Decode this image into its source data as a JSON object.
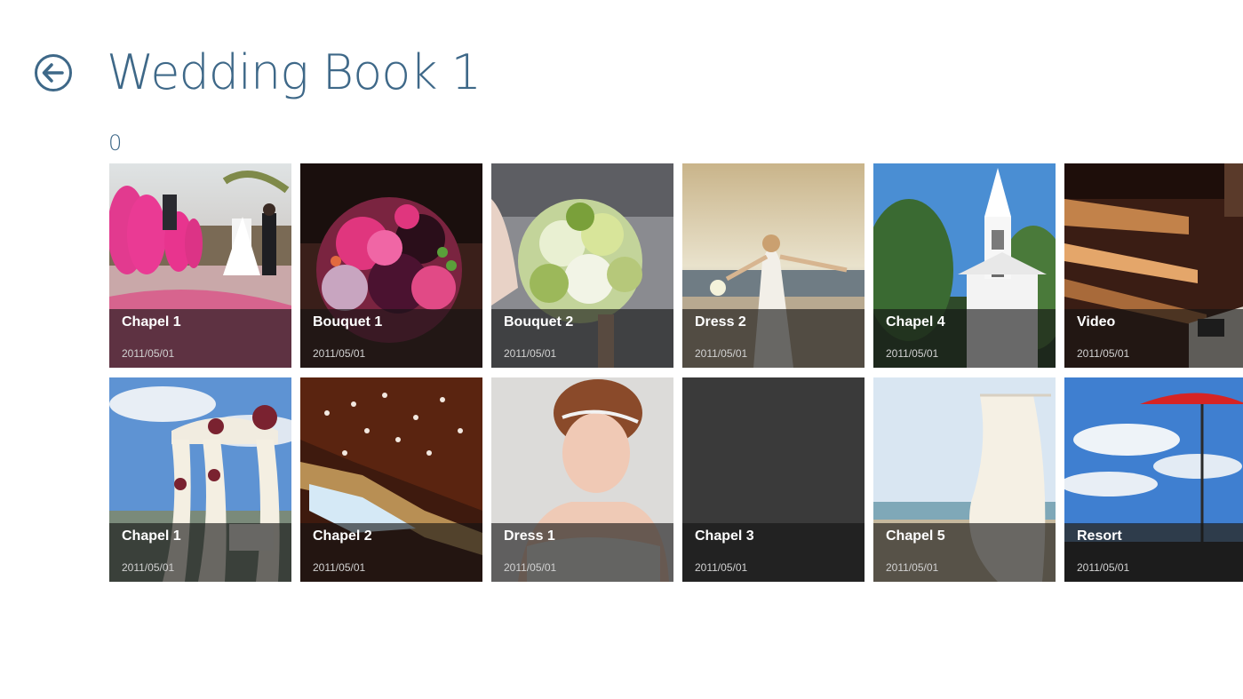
{
  "header": {
    "title": "Wedding Book 1",
    "back_icon": "back-arrow-circle-icon",
    "accent_color": "#3e6888"
  },
  "group": {
    "label": "0"
  },
  "tiles": [
    {
      "title": "Chapel 1",
      "date": "2011/05/01",
      "image": "pink parasols and aisle with rose petals"
    },
    {
      "title": "Bouquet 1",
      "date": "2011/05/01",
      "image": "pink and dark purple bouquet"
    },
    {
      "title": "Bouquet 2",
      "date": "2011/05/01",
      "image": "green and white bouquet"
    },
    {
      "title": "Dress 2",
      "date": "2011/05/01",
      "image": "bride on beach at sunset"
    },
    {
      "title": "Chapel 4",
      "date": "2011/05/01",
      "image": "white chapel steeple with trees"
    },
    {
      "title": "Video",
      "date": "2011/05/01",
      "image": "candle-lit shelves"
    },
    {
      "title": "Chapel 1",
      "date": "2011/05/01",
      "image": "white draped arbor with roses"
    },
    {
      "title": "Chapel 2",
      "date": "2011/05/01",
      "image": "petals falling under wooden beams"
    },
    {
      "title": "Dress 1",
      "date": "2011/05/01",
      "image": "bride with tiara"
    },
    {
      "title": "Chapel 3",
      "date": "2011/05/01",
      "image": ""
    },
    {
      "title": "Chapel 5",
      "date": "2011/05/01",
      "image": "white drape on beach"
    },
    {
      "title": "Resort",
      "date": "2011/05/01",
      "image": "red umbrella under blue sky"
    }
  ]
}
